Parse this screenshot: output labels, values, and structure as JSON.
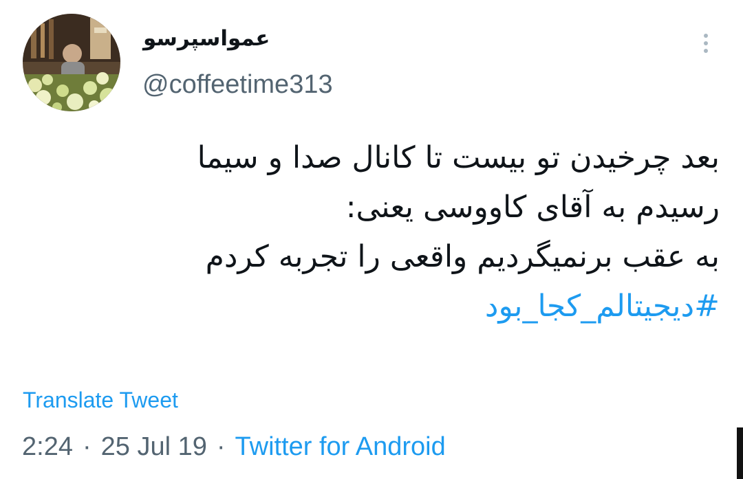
{
  "tweet": {
    "display_name": "عمواسپرسو",
    "handle": "@coffeetime313",
    "text_lines": [
      "بعد چرخیدن تو بیست تا کانال صدا و سیما",
      "رسیدم به آقای کاووسی یعنی:",
      "به عقب برنمیگردیم  واقعی را تجربه کردم"
    ],
    "hashtag": "#دیجیتالم_کجا_بود",
    "translate_label": "Translate Tweet",
    "time": "2:24",
    "date": "25 Jul 19",
    "separator": "·",
    "source": "Twitter for Android"
  },
  "colors": {
    "link": "#1d9bf0",
    "text": "#0f1419",
    "secondary": "#536471"
  },
  "icons": {
    "menu": "more-vertical-icon",
    "avatar": "profile-photo"
  }
}
